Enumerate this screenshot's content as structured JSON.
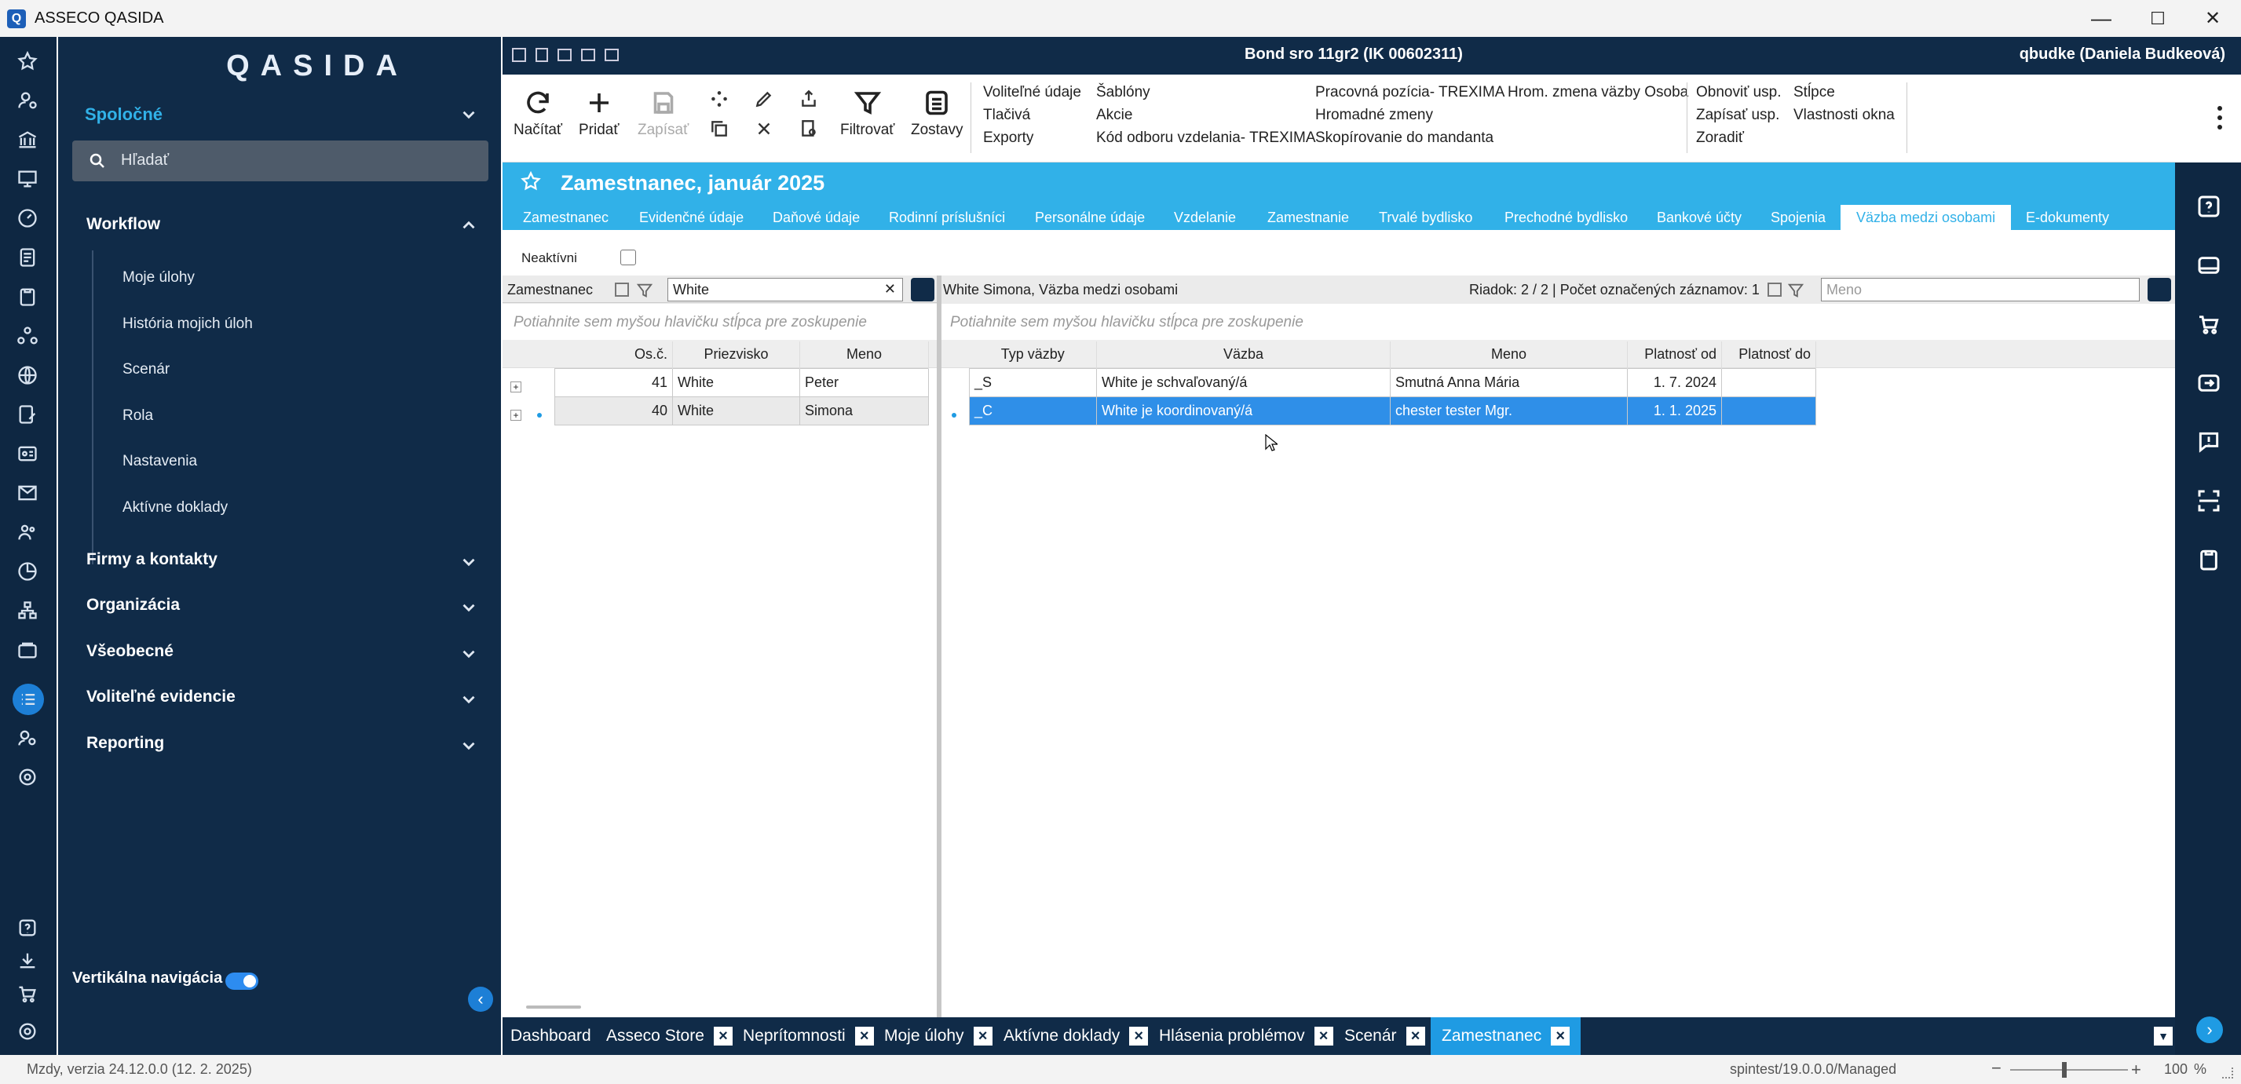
{
  "window": {
    "title": "ASSECO QASIDA",
    "minimize": "—",
    "maximize": "☐",
    "close": "✕"
  },
  "sidebar": {
    "logo": "QASIDA",
    "section_common": "Spoločné",
    "search_placeholder": "Hľadať",
    "workflow": "Workflow",
    "workflow_items": [
      "Moje úlohy",
      "História mojich úloh",
      "Scenár",
      "Rola",
      "Nastavenia",
      "Aktívne doklady"
    ],
    "sections": [
      "Firmy a kontakty",
      "Organizácia",
      "Všeobecné",
      "Voliteľné evidencie",
      "Reporting"
    ],
    "vertical_nav": "Vertikálna navigácia"
  },
  "topbar": {
    "company": "Bond sro 11gr2 (IK 00602311)",
    "user": "qbudke (Daniela Budkeová)"
  },
  "ribbon": {
    "buttons": [
      "Načítať",
      "Pridať",
      "Zapísať",
      "Filtrovať",
      "Zostavy"
    ],
    "col1": [
      "Voliteľné údaje",
      "Tlačivá",
      "Exporty"
    ],
    "col2": [
      "Šablóny",
      "Akcie",
      "Kód odboru vzdelania- TREXIMA"
    ],
    "col3": [
      "Pracovná pozícia- TREXIMA",
      "Hromadné zmeny",
      "Skopírovanie do mandanta"
    ],
    "col4": [
      "Hrom. zmena väzby Osoba"
    ],
    "col5": [
      "Obnoviť usp.",
      "Zapísať usp.",
      "Zoradiť"
    ],
    "col6": [
      "Stĺpce",
      "Vlastnosti okna"
    ]
  },
  "content": {
    "title": "Zamestnanec, január 2025",
    "tabs": [
      "Zamestnanec",
      "Evidenčné údaje",
      "Daňové údaje",
      "Rodinní príslušníci",
      "Personálne údaje",
      "Vzdelanie",
      "Zamestnanie",
      "Trvalé bydlisko",
      "Prechodné bydlisko",
      "Bankové účty",
      "Spojenia",
      "Väzba medzi osobami",
      "E-dokumenty"
    ],
    "inactive_label": "Neaktívni",
    "left": {
      "label": "Zamestnanec",
      "filter_value": "White",
      "group_hint": "Potiahnite sem myšou hlavičku stĺpca pre zoskupenie",
      "columns": [
        "Os.č.",
        "Priezvisko",
        "Meno"
      ],
      "rows": [
        [
          "41",
          "White",
          "Peter"
        ],
        [
          "40",
          "White",
          "Simona"
        ]
      ]
    },
    "right": {
      "label": "White Simona, Väzba medzi osobami",
      "row_info": "Riadok: 2 / 2 | Počet označených záznamov: 1",
      "filter_placeholder": "Meno",
      "group_hint": "Potiahnite sem myšou hlavičku stĺpca pre zoskupenie",
      "columns": [
        "Typ väzby",
        "Väzba",
        "Meno",
        "Platnosť od",
        "Platnosť do"
      ],
      "rows": [
        [
          "_S",
          "White je schvaľovaný/á",
          "Smutná Anna Mária",
          "1. 7. 2024",
          ""
        ],
        [
          "_C",
          "White je koordinovaný/á",
          "chester tester Mgr.",
          "1. 1. 2025",
          ""
        ]
      ]
    }
  },
  "bottom_tabs": [
    "Dashboard",
    "Asseco Store",
    "Neprítomnosti",
    "Moje úlohy",
    "Aktívne doklady",
    "Hlásenia problémov",
    "Scenár",
    "Zamestnanec"
  ],
  "status": {
    "version": "Mzdy, verzia 24.12.0.0 (12. 2. 2025)",
    "server": "spintest/19.0.0.0/Managed",
    "zoom": "100",
    "zoom_unit": "%"
  },
  "colors": {
    "accent": "#31b1e8",
    "nav": "#102b48",
    "selection": "#2f8fe8"
  }
}
